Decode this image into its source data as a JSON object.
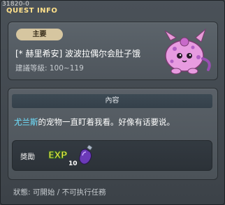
{
  "window": {
    "quest_id": "31820-0",
    "title": "QUEST INFO"
  },
  "quest": {
    "badge": "主要",
    "title": "[* 赫里希安] 波波拉偶尔会肚子饿",
    "level": "建議等級: 100~119",
    "mascot_icon": "pink-spotted-creature-mascot"
  },
  "content": {
    "header": "內容",
    "npc_name": "尤兰斯",
    "text": "的宠物一直盯着我看。好像有话要说。"
  },
  "reward": {
    "label": "獎勵",
    "exp_icon_text": "EXP",
    "item_icon": "purple-potion-icon",
    "item_count": "10"
  },
  "status": {
    "text": "狀態: 可開始 / 不可执行任務"
  },
  "colors": {
    "title": "#ffe08a",
    "npc_name": "#6fe0ff",
    "badge_bg": "#d6c6a0"
  }
}
